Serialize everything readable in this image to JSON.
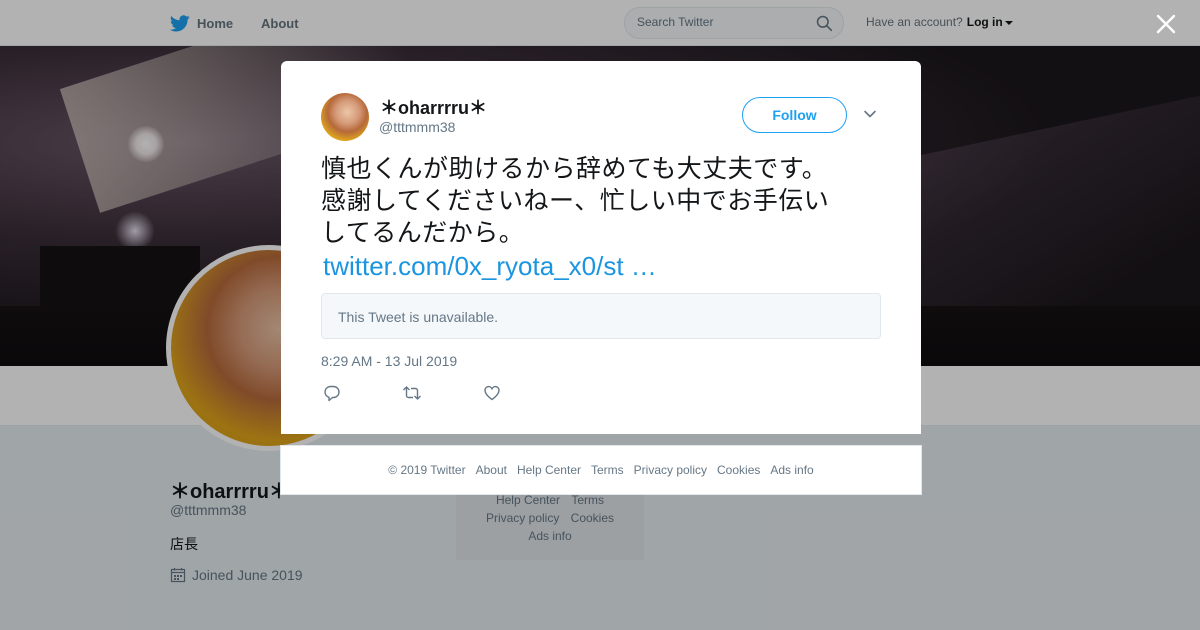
{
  "topbar": {
    "home_label": "Home",
    "about_label": "About",
    "search_placeholder": "Search Twitter",
    "account_prompt": "Have an account?",
    "login_label": "Log in",
    "icons": [
      "twitter-bird-icon",
      "search-icon",
      "caret-down-icon"
    ]
  },
  "profile": {
    "name": "＊oharrrru＊",
    "handle": "@tttmmm38",
    "bio": "店長",
    "joined": "Joined June 2019"
  },
  "background_footer": {
    "row1": [
      "Help Center",
      "Terms"
    ],
    "row2": [
      "Privacy policy",
      "Cookies"
    ],
    "row3": [
      "Ads info"
    ]
  },
  "tweet": {
    "author_name": "＊oharrrru＊",
    "author_handle": "@tttmmm38",
    "follow_label": "Follow",
    "text_lines": [
      "慎也くんが助けるから辞めても大丈夫です。",
      "感謝してくださいねー、忙しい中でお手伝い",
      "してるんだから。"
    ],
    "link_text": "twitter.com/0x_ryota_x0/st …",
    "quoted_status": "This Tweet is unavailable.",
    "timestamp": "8:29 AM - 13 Jul 2019",
    "action_icons": [
      "reply-icon",
      "retweet-icon",
      "like-icon"
    ]
  },
  "modal_footer": {
    "links": [
      "© 2019 Twitter",
      "About",
      "Help Center",
      "Terms",
      "Privacy policy",
      "Cookies",
      "Ads info"
    ]
  },
  "colors": {
    "accent": "#1da1f2",
    "link": "#1b95e0",
    "muted": "#657786",
    "background": "#e6ecf0"
  }
}
